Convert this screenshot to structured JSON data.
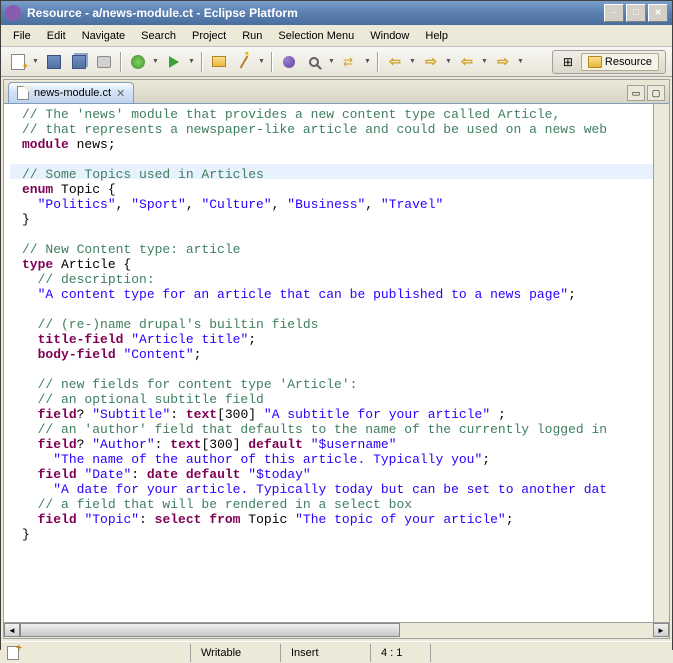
{
  "window": {
    "title": "Resource - a/news-module.ct - Eclipse Platform"
  },
  "menubar": {
    "items": [
      "File",
      "Edit",
      "Navigate",
      "Search",
      "Project",
      "Run",
      "Selection Menu",
      "Window",
      "Help"
    ]
  },
  "perspective": {
    "label": "Resource"
  },
  "editor": {
    "tab_label": "news-module.ct"
  },
  "code": {
    "lines": [
      {
        "t": "comment",
        "s": "// The 'news' module that provides a new content type called Article,"
      },
      {
        "t": "comment",
        "s": "// that represents a newspaper-like article and could be used on a news web"
      },
      {
        "segs": [
          {
            "t": "keyword",
            "s": "module"
          },
          {
            "t": "ident",
            "s": " news;"
          }
        ]
      },
      {
        "t": "blank",
        "s": ""
      },
      {
        "t": "comment",
        "s": "// Some Topics used in Articles"
      },
      {
        "segs": [
          {
            "t": "keyword",
            "s": "enum"
          },
          {
            "t": "ident",
            "s": " Topic {"
          }
        ]
      },
      {
        "segs": [
          {
            "t": "ident",
            "s": "  "
          },
          {
            "t": "string",
            "s": "\"Politics\""
          },
          {
            "t": "ident",
            "s": ", "
          },
          {
            "t": "string",
            "s": "\"Sport\""
          },
          {
            "t": "ident",
            "s": ", "
          },
          {
            "t": "string",
            "s": "\"Culture\""
          },
          {
            "t": "ident",
            "s": ", "
          },
          {
            "t": "string",
            "s": "\"Business\""
          },
          {
            "t": "ident",
            "s": ", "
          },
          {
            "t": "string",
            "s": "\"Travel\""
          }
        ]
      },
      {
        "t": "ident",
        "s": "}"
      },
      {
        "t": "blank",
        "s": ""
      },
      {
        "t": "comment",
        "s": "// New Content type: article"
      },
      {
        "segs": [
          {
            "t": "keyword",
            "s": "type"
          },
          {
            "t": "ident",
            "s": " Article {"
          }
        ]
      },
      {
        "t": "comment",
        "s": "  // description:"
      },
      {
        "segs": [
          {
            "t": "ident",
            "s": "  "
          },
          {
            "t": "string",
            "s": "\"A content type for an article that can be published to a news page\""
          },
          {
            "t": "ident",
            "s": ";"
          }
        ]
      },
      {
        "t": "blank",
        "s": ""
      },
      {
        "t": "comment",
        "s": "  // (re-)name drupal's builtin fields"
      },
      {
        "segs": [
          {
            "t": "ident",
            "s": "  "
          },
          {
            "t": "keyword",
            "s": "title-field"
          },
          {
            "t": "ident",
            "s": " "
          },
          {
            "t": "string",
            "s": "\"Article title\""
          },
          {
            "t": "ident",
            "s": ";"
          }
        ]
      },
      {
        "segs": [
          {
            "t": "ident",
            "s": "  "
          },
          {
            "t": "keyword",
            "s": "body-field"
          },
          {
            "t": "ident",
            "s": " "
          },
          {
            "t": "string",
            "s": "\"Content\""
          },
          {
            "t": "ident",
            "s": ";"
          }
        ]
      },
      {
        "t": "blank",
        "s": ""
      },
      {
        "t": "comment",
        "s": "  // new fields for content type 'Article':"
      },
      {
        "t": "comment",
        "s": "  // an optional subtitle field"
      },
      {
        "segs": [
          {
            "t": "ident",
            "s": "  "
          },
          {
            "t": "keyword",
            "s": "field"
          },
          {
            "t": "ident",
            "s": "? "
          },
          {
            "t": "string",
            "s": "\"Subtitle\""
          },
          {
            "t": "ident",
            "s": ": "
          },
          {
            "t": "keyword",
            "s": "text"
          },
          {
            "t": "ident",
            "s": "[300] "
          },
          {
            "t": "string",
            "s": "\"A subtitle for your article\""
          },
          {
            "t": "ident",
            "s": " ;"
          }
        ]
      },
      {
        "t": "comment",
        "s": "  // an 'author' field that defaults to the name of the currently logged in"
      },
      {
        "segs": [
          {
            "t": "ident",
            "s": "  "
          },
          {
            "t": "keyword",
            "s": "field"
          },
          {
            "t": "ident",
            "s": "? "
          },
          {
            "t": "string",
            "s": "\"Author\""
          },
          {
            "t": "ident",
            "s": ": "
          },
          {
            "t": "keyword",
            "s": "text"
          },
          {
            "t": "ident",
            "s": "[300] "
          },
          {
            "t": "keyword",
            "s": "default"
          },
          {
            "t": "ident",
            "s": " "
          },
          {
            "t": "string",
            "s": "\"$username\""
          }
        ]
      },
      {
        "segs": [
          {
            "t": "ident",
            "s": "    "
          },
          {
            "t": "string",
            "s": "\"The name of the author of this article. Typically you\""
          },
          {
            "t": "ident",
            "s": ";"
          }
        ]
      },
      {
        "segs": [
          {
            "t": "ident",
            "s": "  "
          },
          {
            "t": "keyword",
            "s": "field"
          },
          {
            "t": "ident",
            "s": " "
          },
          {
            "t": "string",
            "s": "\"Date\""
          },
          {
            "t": "ident",
            "s": ": "
          },
          {
            "t": "keyword",
            "s": "date default"
          },
          {
            "t": "ident",
            "s": " "
          },
          {
            "t": "string",
            "s": "\"$today\""
          }
        ]
      },
      {
        "segs": [
          {
            "t": "ident",
            "s": "    "
          },
          {
            "t": "string",
            "s": "\"A date for your article. Typically today but can be set to another dat"
          }
        ]
      },
      {
        "t": "comment",
        "s": "  // a field that will be rendered in a select box"
      },
      {
        "segs": [
          {
            "t": "ident",
            "s": "  "
          },
          {
            "t": "keyword",
            "s": "field"
          },
          {
            "t": "ident",
            "s": " "
          },
          {
            "t": "string",
            "s": "\"Topic\""
          },
          {
            "t": "ident",
            "s": ": "
          },
          {
            "t": "keyword",
            "s": "select from"
          },
          {
            "t": "ident",
            "s": " Topic "
          },
          {
            "t": "string",
            "s": "\"The topic of your article\""
          },
          {
            "t": "ident",
            "s": ";"
          }
        ]
      },
      {
        "t": "ident",
        "s": "}"
      }
    ]
  },
  "statusbar": {
    "writable": "Writable",
    "insert": "Insert",
    "pos": "4 : 1"
  }
}
